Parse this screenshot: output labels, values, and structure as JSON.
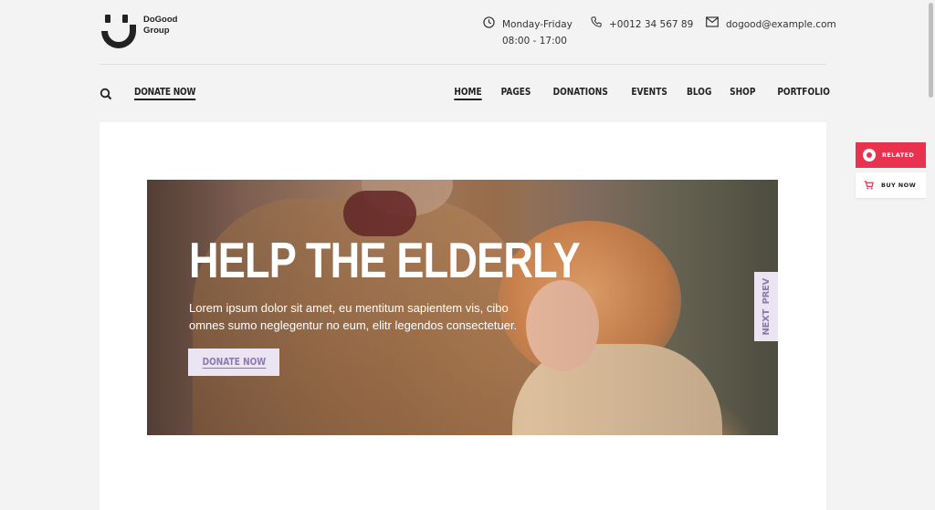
{
  "brand": {
    "line1": "DoGood",
    "line2": "Group"
  },
  "contact": {
    "hours_line1": "Monday-Friday",
    "hours_line2": "08:00 - 17:00",
    "phone": "+0012 34 567 89",
    "email": "dogood@example.com"
  },
  "nav": {
    "donate_label": "DONATE NOW",
    "items": [
      {
        "label": "HOME",
        "active": true
      },
      {
        "label": "PAGES"
      },
      {
        "label": "DONATIONS"
      },
      {
        "label": "EVENTS"
      },
      {
        "label": "BLOG"
      },
      {
        "label": "SHOP"
      },
      {
        "label": "PORTFOLIO"
      }
    ]
  },
  "hero": {
    "title": "HELP THE ELDERLY",
    "text": "Lorem ipsum dolor sit amet, eu mentitum sapientem vis, cibo omnes sumo neglegentur no eum, elitr legendos consectetuer.",
    "button_label": "DONATE NOW",
    "prev_label": "PREV",
    "next_label": "NEXT"
  },
  "side_buttons": {
    "related_label": "RELATED",
    "buy_label": "BUY NOW"
  },
  "colors": {
    "accent_pink": "#e8324f",
    "lavender": "#ebe4f3",
    "lavender_text": "#8b7aaf",
    "text_dark": "#222222"
  },
  "icons": [
    "smile-logo-icon",
    "clock-icon",
    "phone-icon",
    "mail-icon",
    "search-icon",
    "related-icon",
    "cart-icon"
  ]
}
